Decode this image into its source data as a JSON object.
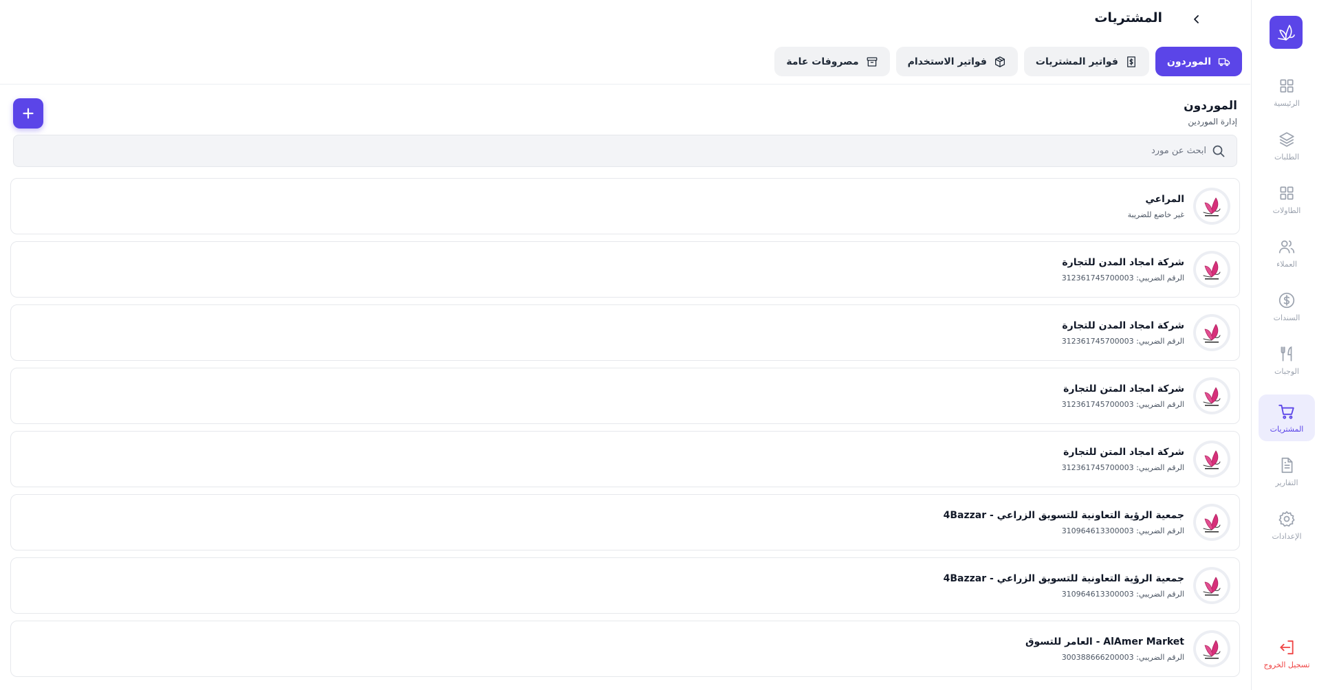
{
  "header": {
    "title": "المشتريات"
  },
  "tabs": [
    {
      "label": "الموردون",
      "icon": "truck-icon",
      "active": true
    },
    {
      "label": "فواتير المشتريات",
      "icon": "receipt-icon",
      "active": false
    },
    {
      "label": "فواتير الاستخدام",
      "icon": "package-icon",
      "active": false
    },
    {
      "label": "مصروفات عامة",
      "icon": "archive-icon",
      "active": false
    }
  ],
  "section": {
    "title": "الموردون",
    "subtitle": "إدارة الموردين"
  },
  "search": {
    "placeholder": "ابحث عن مورد",
    "value": ""
  },
  "sidebar": {
    "items": [
      {
        "label": "الرئيسية",
        "icon": "grid-icon"
      },
      {
        "label": "الطلبات",
        "icon": "layers-icon"
      },
      {
        "label": "الطاولات",
        "icon": "tables-icon"
      },
      {
        "label": "العملاء",
        "icon": "users-icon"
      },
      {
        "label": "السندات",
        "icon": "dollar-icon"
      },
      {
        "label": "الوجبات",
        "icon": "utensils-icon"
      },
      {
        "label": "المشتريات",
        "icon": "cart-icon",
        "active": true
      },
      {
        "label": "التقارير",
        "icon": "file-text-icon"
      },
      {
        "label": "الإعدادات",
        "icon": "settings-icon"
      }
    ],
    "logout_label": "تسجيل الخروج"
  },
  "suppliers": [
    {
      "name": "المراعي",
      "sub": "غير خاضع للضريبة"
    },
    {
      "name": "شركة امجاد المدن للتجارة",
      "sub": "الرقم الضريبي: 312361745700003"
    },
    {
      "name": "شركة امجاد المدن للتجارة",
      "sub": "الرقم الضريبي: 312361745700003"
    },
    {
      "name": "شركة امجاد المتن للتجارة",
      "sub": "الرقم الضريبي: 312361745700003"
    },
    {
      "name": "شركة امجاد المتن للتجارة",
      "sub": "الرقم الضريبي: 312361745700003"
    },
    {
      "name": "4Bazzar - جمعية الرؤية التعاونية للتسويق الزراعي",
      "sub": "الرقم الضريبي: 310964613300003"
    },
    {
      "name": "4Bazzar - جمعية الرؤية التعاونية للتسويق الزراعي",
      "sub": "الرقم الضريبي: 310964613300003"
    },
    {
      "name": "العامر للتسوق - AlAmer Market",
      "sub": "الرقم الضريبي: 300388666200003"
    }
  ],
  "colors": {
    "accent": "#5b45e8",
    "accent_soft": "#ededfd",
    "logout": "#ef4444",
    "logo_pink": "#d6307a"
  }
}
